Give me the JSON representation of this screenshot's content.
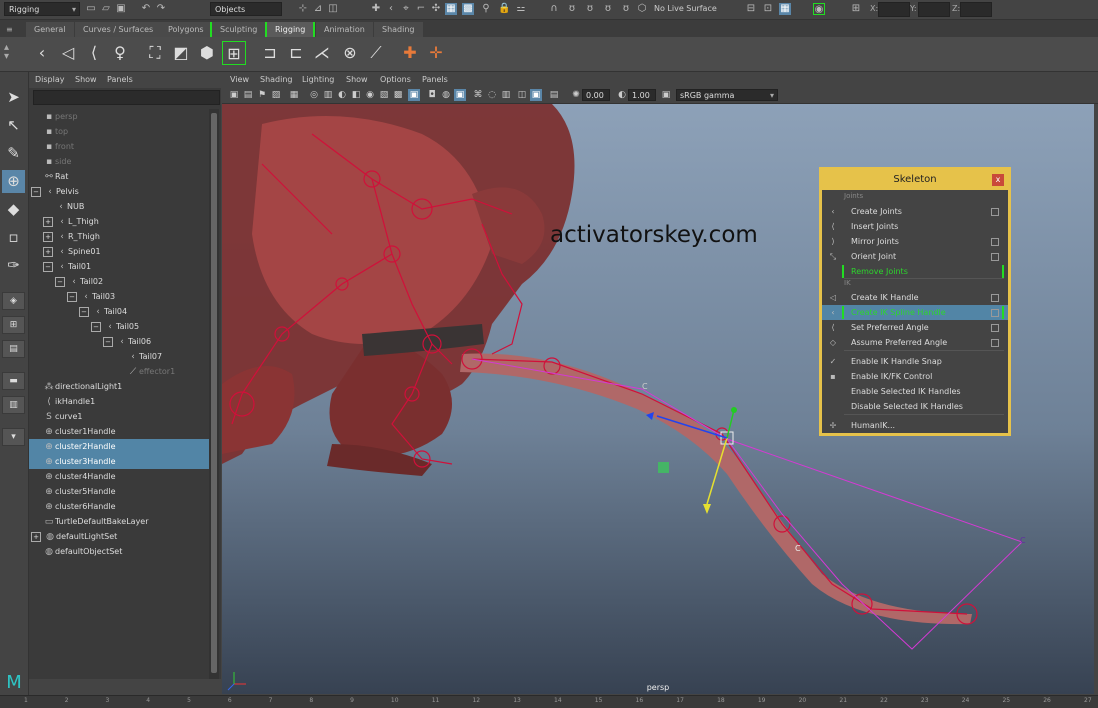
{
  "status_line": {
    "menu_set": "Rigging",
    "selection_mode": "Objects",
    "live_surface": "No Live Surface",
    "coord_labels": [
      "X:",
      "Y:",
      "Z:"
    ]
  },
  "shelf_tabs": [
    {
      "label": "General"
    },
    {
      "label": "Curves / Surfaces"
    },
    {
      "label": "Polygons"
    },
    {
      "label": "Sculpting"
    },
    {
      "label": "Rigging"
    },
    {
      "label": "Animation"
    },
    {
      "label": "Shading"
    }
  ],
  "outliner": {
    "menu": [
      "Display",
      "Show",
      "Panels"
    ],
    "items": [
      {
        "label": "persp",
        "indent": 0,
        "icon": "camera-icon",
        "state": "dim"
      },
      {
        "label": "top",
        "indent": 0,
        "icon": "camera-icon",
        "state": "dim"
      },
      {
        "label": "front",
        "indent": 0,
        "icon": "camera-icon",
        "state": "dim"
      },
      {
        "label": "side",
        "indent": 0,
        "icon": "camera-icon",
        "state": "dim"
      },
      {
        "label": "Rat",
        "indent": 0,
        "icon": "group-icon",
        "state": ""
      },
      {
        "label": "Pelvis",
        "indent": 0,
        "icon": "joint-icon",
        "state": "",
        "exp": "-"
      },
      {
        "label": "NUB",
        "indent": 1,
        "icon": "joint-icon",
        "state": ""
      },
      {
        "label": "L_Thigh",
        "indent": 1,
        "icon": "joint-icon",
        "state": "",
        "exp": "+"
      },
      {
        "label": "R_Thigh",
        "indent": 1,
        "icon": "joint-icon",
        "state": "",
        "exp": "+"
      },
      {
        "label": "Spine01",
        "indent": 1,
        "icon": "joint-icon",
        "state": "",
        "exp": "+"
      },
      {
        "label": "Tail01",
        "indent": 1,
        "icon": "joint-icon",
        "state": "",
        "exp": "-"
      },
      {
        "label": "Tail02",
        "indent": 2,
        "icon": "joint-icon",
        "state": "",
        "exp": "-"
      },
      {
        "label": "Tail03",
        "indent": 3,
        "icon": "joint-icon",
        "state": "",
        "exp": "-"
      },
      {
        "label": "Tail04",
        "indent": 4,
        "icon": "joint-icon",
        "state": "",
        "exp": "-"
      },
      {
        "label": "Tail05",
        "indent": 5,
        "icon": "joint-icon",
        "state": "",
        "exp": "-"
      },
      {
        "label": "Tail06",
        "indent": 6,
        "icon": "joint-icon",
        "state": "",
        "exp": "-"
      },
      {
        "label": "Tail07",
        "indent": 7,
        "icon": "joint-icon",
        "state": ""
      },
      {
        "label": "effector1",
        "indent": 7,
        "icon": "effector-icon",
        "state": "dim"
      },
      {
        "label": "directionalLight1",
        "indent": 0,
        "icon": "light-icon",
        "state": ""
      },
      {
        "label": "ikHandle1",
        "indent": 0,
        "icon": "ik-handle-icon",
        "state": ""
      },
      {
        "label": "curve1",
        "indent": 0,
        "icon": "curve-icon",
        "state": ""
      },
      {
        "label": "cluster1Handle",
        "indent": 0,
        "icon": "cluster-icon",
        "state": ""
      },
      {
        "label": "cluster2Handle",
        "indent": 0,
        "icon": "cluster-icon",
        "state": "sel"
      },
      {
        "label": "cluster3Handle",
        "indent": 0,
        "icon": "cluster-icon",
        "state": "sel"
      },
      {
        "label": "cluster4Handle",
        "indent": 0,
        "icon": "cluster-icon",
        "state": ""
      },
      {
        "label": "cluster5Handle",
        "indent": 0,
        "icon": "cluster-icon",
        "state": ""
      },
      {
        "label": "cluster6Handle",
        "indent": 0,
        "icon": "cluster-icon",
        "state": ""
      },
      {
        "label": "TurtleDefaultBakeLayer",
        "indent": 0,
        "icon": "layer-icon",
        "state": ""
      },
      {
        "label": "defaultLightSet",
        "indent": 0,
        "icon": "set-icon",
        "state": "",
        "exp": "+"
      },
      {
        "label": "defaultObjectSet",
        "indent": 0,
        "icon": "set-icon",
        "state": ""
      }
    ]
  },
  "viewport": {
    "menu": [
      "View",
      "Shading",
      "Lighting",
      "Show",
      "Options",
      "Panels"
    ],
    "gamma_value": "0.00",
    "exposure_value": "1.00",
    "color_space": "sRGB gamma",
    "camera_label": "persp",
    "curve_labels": [
      "C",
      "C",
      "C"
    ]
  },
  "watermark": "activatorskey.com",
  "skeleton_menu": {
    "title": "Skeleton",
    "close": "x",
    "sections": [
      "Joints",
      "IK"
    ],
    "items": [
      {
        "label": "Create Joints",
        "box": true
      },
      {
        "label": "Insert Joints",
        "box": false
      },
      {
        "label": "Mirror Joints",
        "box": true
      },
      {
        "label": "Orient Joint",
        "box": true
      },
      {
        "label": "Remove Joints",
        "box": false
      },
      {
        "label": "Create IK Handle",
        "box": true
      },
      {
        "label": "Create IK Spline Handle",
        "box": true
      },
      {
        "label": "Set Preferred Angle",
        "box": true
      },
      {
        "label": "Assume Preferred Angle",
        "box": true
      },
      {
        "label": "Enable IK Handle Snap",
        "box": false
      },
      {
        "label": "Enable IK/FK Control",
        "box": false
      },
      {
        "label": "Enable Selected IK Handles",
        "box": false
      },
      {
        "label": "Disable Selected IK Handles",
        "box": false
      },
      {
        "label": "HumanIK...",
        "box": false
      }
    ]
  },
  "timeline": {
    "ticks": [
      "1",
      "2",
      "3",
      "4",
      "5",
      "6",
      "7",
      "8",
      "9",
      "10",
      "11",
      "12",
      "13",
      "14",
      "15",
      "16",
      "17",
      "18",
      "19",
      "20",
      "21",
      "22",
      "23",
      "24",
      "25",
      "26",
      "27"
    ]
  },
  "colors": {
    "selection": "#5285a6",
    "menu_border": "#e6c24a",
    "skeleton": "#d0103a",
    "curve": "#d43ad4",
    "green_bracket": "#22dd22"
  }
}
